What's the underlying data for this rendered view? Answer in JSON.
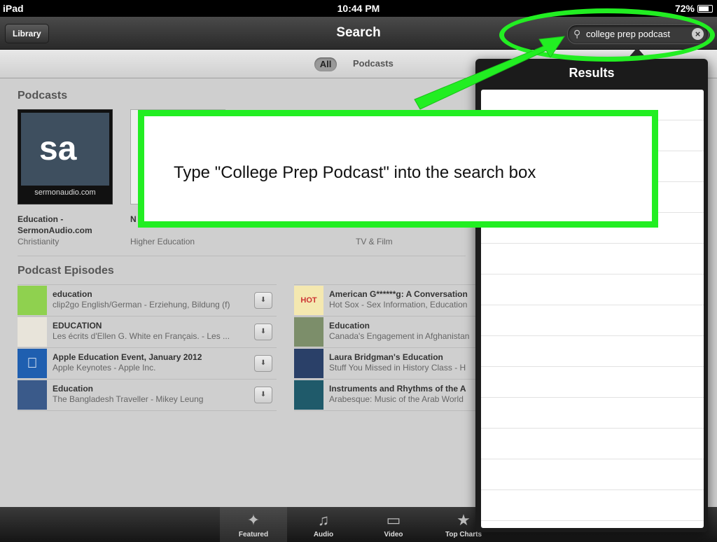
{
  "status": {
    "device": "iPad",
    "time": "10:44 PM",
    "battery": "72%"
  },
  "nav": {
    "library_label": "Library",
    "title": "Search",
    "search_value": "college prep podcast"
  },
  "segments": {
    "all": "All",
    "podcasts": "Podcasts"
  },
  "podcasts_section": {
    "title": "Podcasts",
    "items": [
      {
        "title1": "Education -",
        "title2": "SermonAudio.com",
        "sub": "Christianity",
        "art_text": "sa",
        "art_caption": "sermonaudio.com"
      },
      {
        "title1": "N",
        "title2": "",
        "sub": "Higher Education"
      },
      {
        "title1": "",
        "title2": "",
        "sub": "TV & Film"
      }
    ]
  },
  "episodes_section": {
    "title": "Podcast Episodes",
    "left": [
      {
        "title": "education",
        "sub": "clip2go English/German - Erziehung, Bildung (f)"
      },
      {
        "title": "EDUCATION",
        "sub": "Les écrits d'Ellen G. White en Français. - Les ..."
      },
      {
        "title": "Apple Education Event, January 2012",
        "sub": "Apple Keynotes - Apple Inc."
      },
      {
        "title": "Education",
        "sub": "The Bangladesh Traveller - Mikey Leung"
      }
    ],
    "right": [
      {
        "title": "American G******g: A Conversation",
        "sub": "Hot Sox - Sex Information, Education",
        "art_text": "HOT SOX"
      },
      {
        "title": "Education",
        "sub": "Canada's Engagement in Afghanistan"
      },
      {
        "title": "Laura Bridgman's Education",
        "sub": "Stuff You Missed in History Class - H"
      },
      {
        "title": "Instruments and Rhythms of the A",
        "sub": "Arabesque: Music of the Arab World"
      }
    ]
  },
  "popover": {
    "title": "Results"
  },
  "tabs": [
    {
      "label": "Featured",
      "icon": "featured-icon"
    },
    {
      "label": "Audio",
      "icon": "audio-icon"
    },
    {
      "label": "Video",
      "icon": "video-icon"
    },
    {
      "label": "Top Charts",
      "icon": "star-icon"
    }
  ],
  "annotation": {
    "text": "Type \"College Prep Podcast\" into the search box",
    "color": "#22ee22"
  }
}
